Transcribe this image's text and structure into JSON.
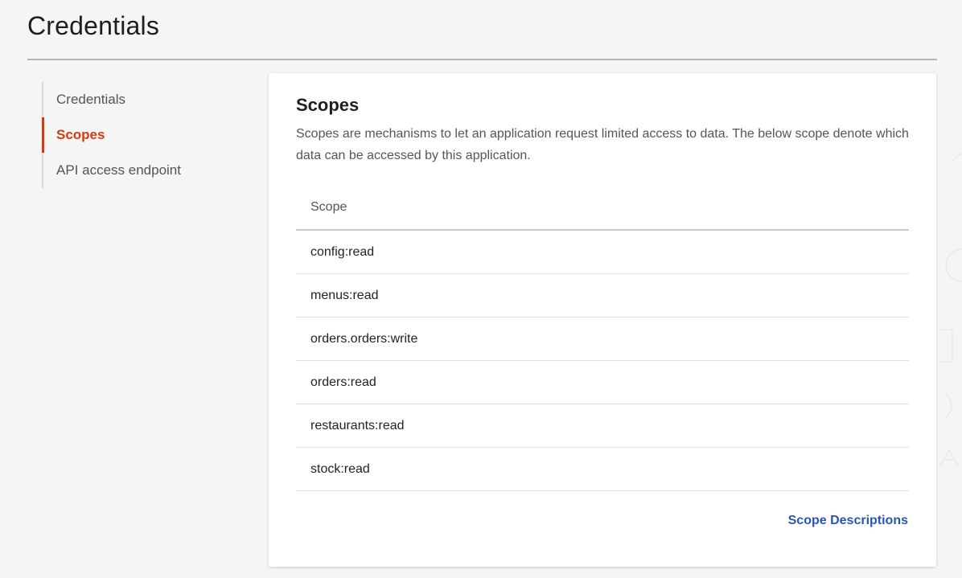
{
  "page": {
    "title": "Credentials"
  },
  "sidebar": {
    "items": [
      {
        "label": "Credentials",
        "active": false
      },
      {
        "label": "Scopes",
        "active": true
      },
      {
        "label": "API access endpoint",
        "active": false
      }
    ]
  },
  "scopes": {
    "title": "Scopes",
    "description": "Scopes are mechanisms to let an application request limited access to data. The below scope denote which data can be accessed by this application.",
    "table": {
      "header": "Scope",
      "rows": [
        "config:read",
        "menus:read",
        "orders.orders:write",
        "orders:read",
        "restaurants:read",
        "stock:read"
      ]
    },
    "link_label": "Scope Descriptions"
  },
  "colors": {
    "accent": "#d43a10",
    "link": "#2a55b5",
    "background": "#f5f5f5"
  }
}
